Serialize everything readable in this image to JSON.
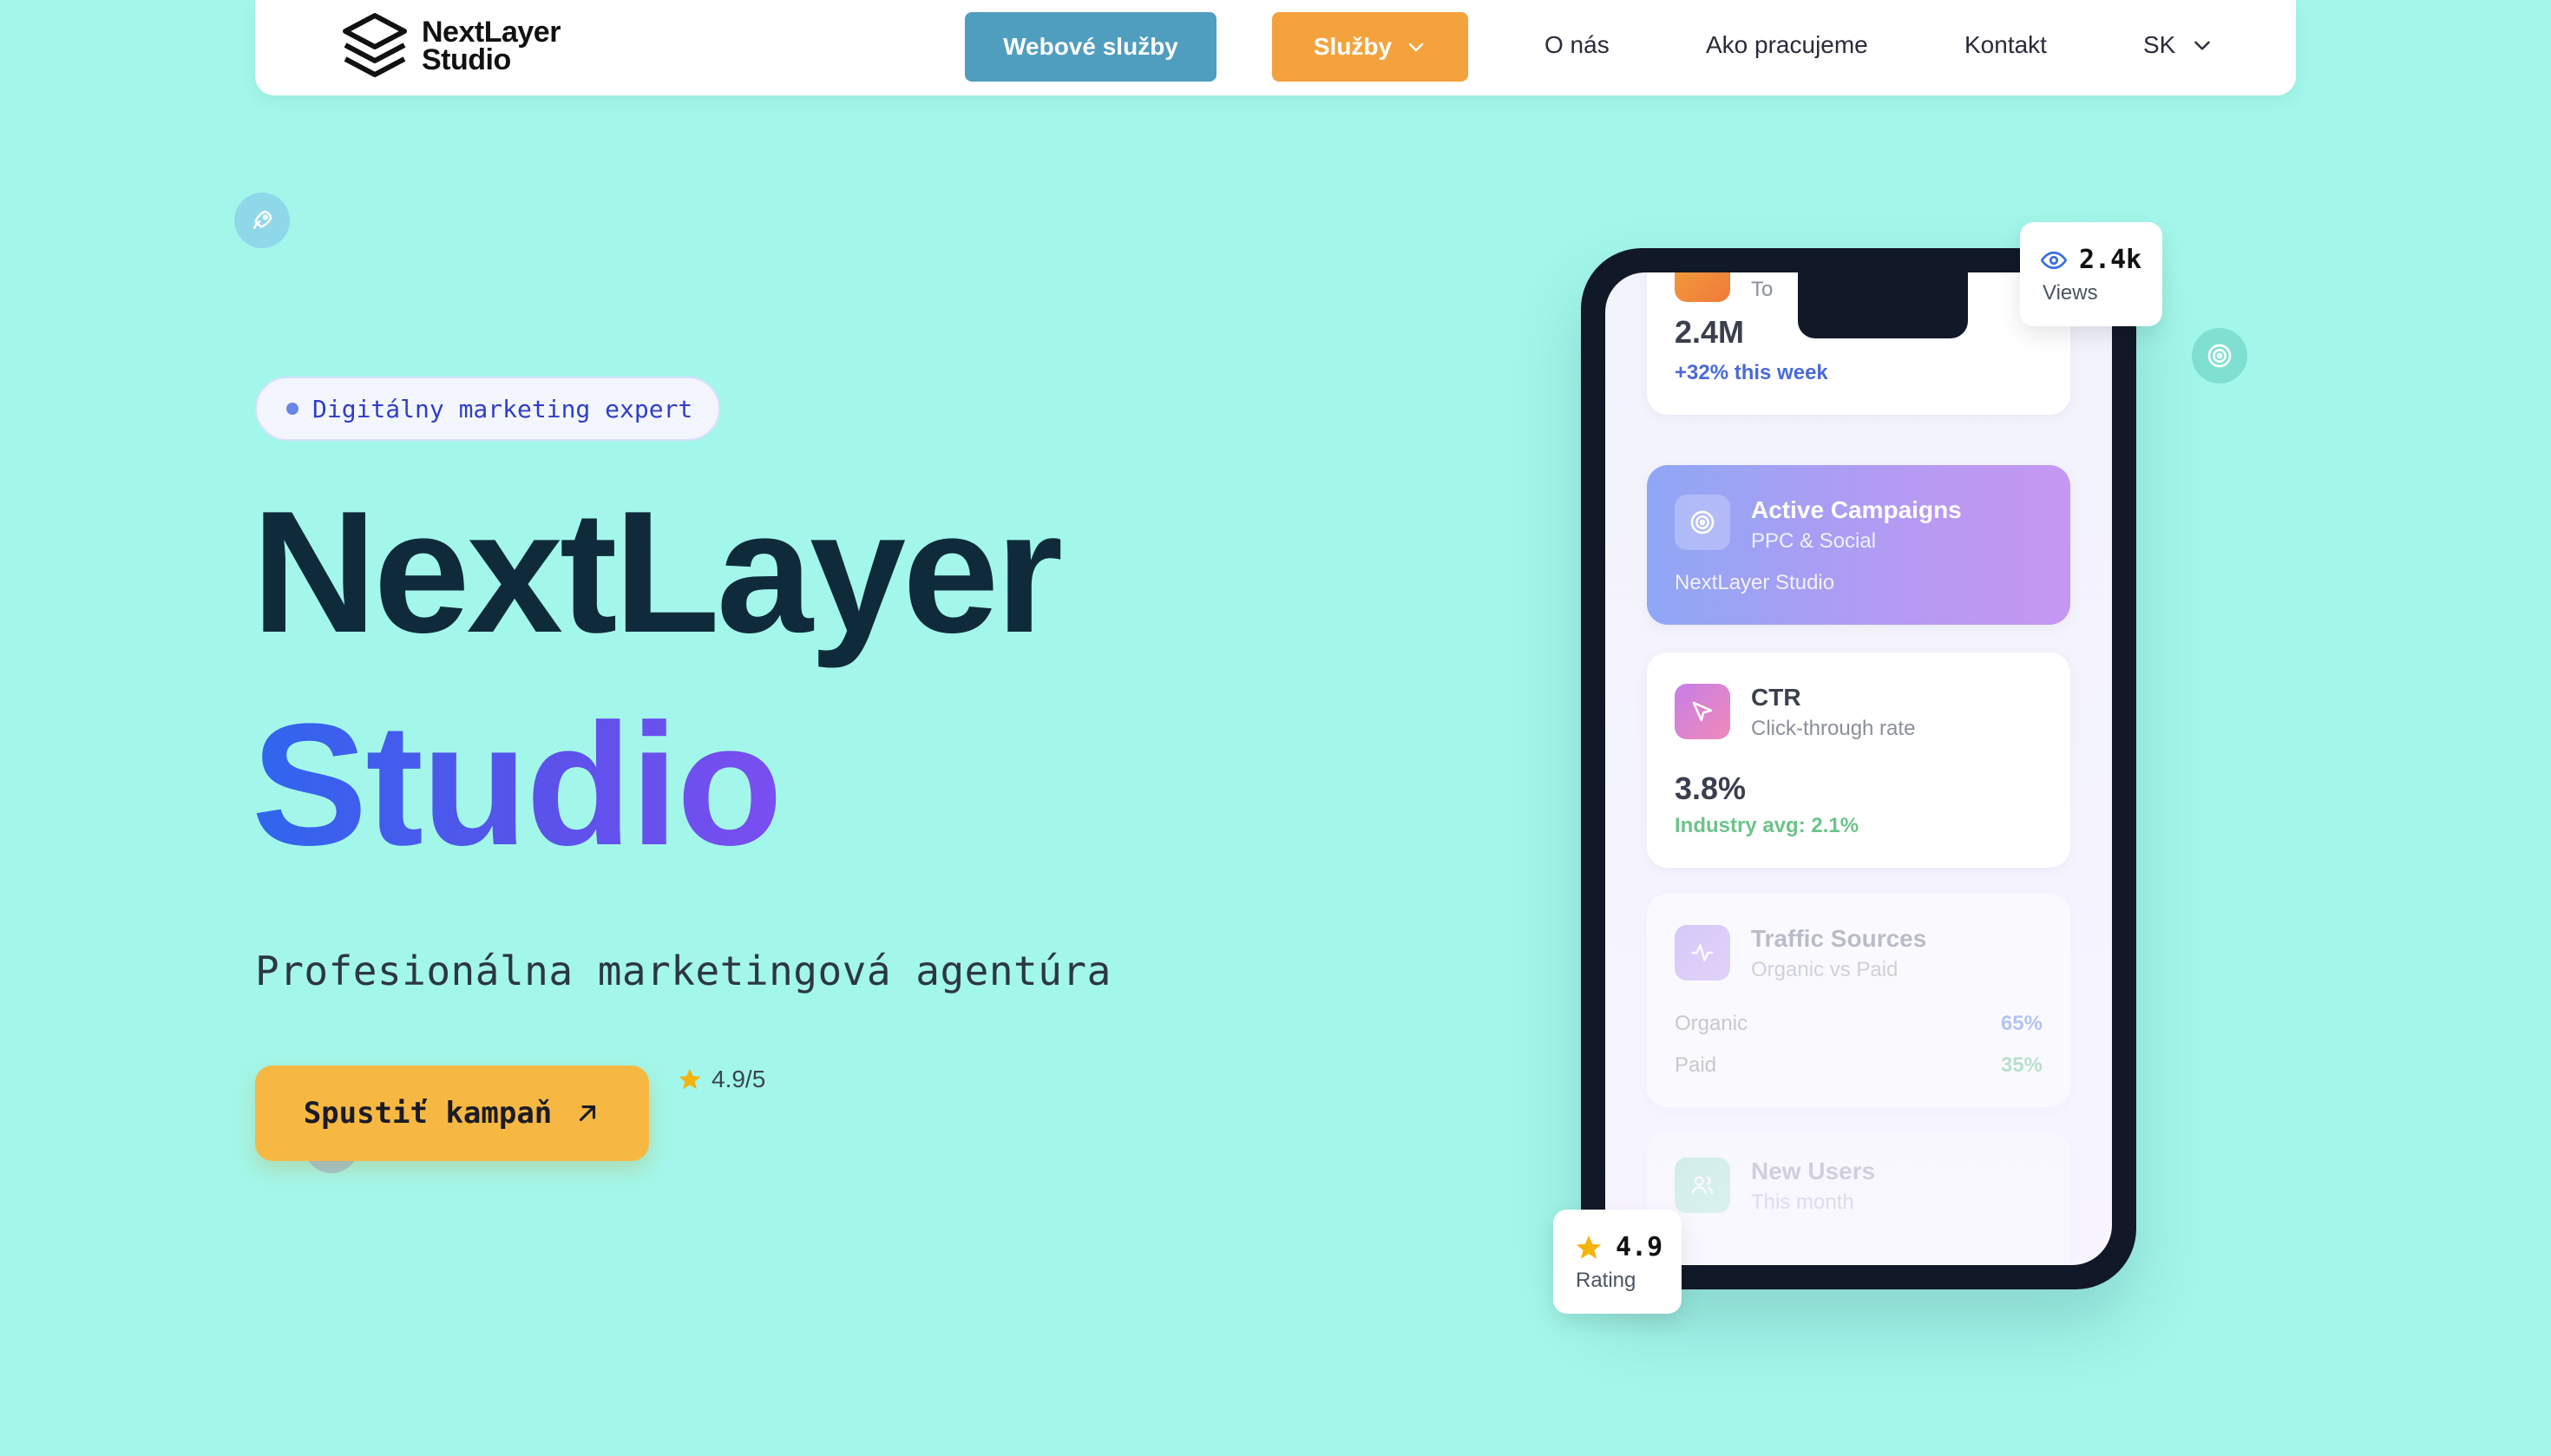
{
  "colors": {
    "background": "#a3f7ea",
    "nav_blue": "#4f9dbf",
    "nav_orange": "#f4a23c",
    "cta": "#f6b842",
    "title_dark": "#0f2b3b",
    "gradient_start": "#2f66ee",
    "gradient_end": "#7b4ef0",
    "phone_frame": "#111827"
  },
  "nav": {
    "logo_line1": "NextLayer",
    "logo_line2": "Studio",
    "web_services": "Webové služby",
    "services": "Služby",
    "about": "O nás",
    "how_we_work": "Ako pracujeme",
    "contact": "Kontakt",
    "language": "SK"
  },
  "hero": {
    "badge": "Digitálny marketing expert",
    "title_line1": "NextLayer",
    "title_line2": "Studio",
    "subtitle": "Profesionálna marketingová agentúra",
    "cta_label": "Spustiť kampaň",
    "rating_inline": "4.9/5"
  },
  "phone": {
    "top_card": {
      "label_partial": "To",
      "value": "2.4M",
      "change": "+32% this week"
    },
    "campaigns": {
      "title": "Active Campaigns",
      "subtitle": "PPC & Social",
      "brand": "NextLayer Studio"
    },
    "ctr": {
      "title": "CTR",
      "subtitle": "Click-through rate",
      "value": "3.8%",
      "note": "Industry avg: 2.1%"
    },
    "traffic": {
      "title": "Traffic Sources",
      "subtitle": "Organic vs Paid",
      "rows": [
        {
          "label": "Organic",
          "value": "65%"
        },
        {
          "label": "Paid",
          "value": "35%"
        }
      ]
    },
    "new_users": {
      "title": "New Users",
      "subtitle": "This month"
    }
  },
  "floating": {
    "views_value": "2.4k",
    "views_label": "Views",
    "rating_value": "4.9",
    "rating_label": "Rating"
  }
}
